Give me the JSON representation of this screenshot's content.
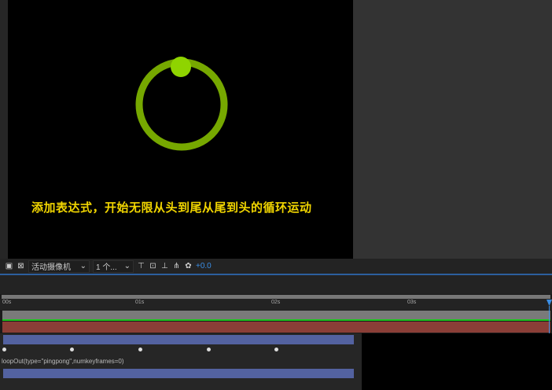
{
  "viewer": {
    "caption": "添加表达式，开始无限从头到尾从尾到头的循环运动",
    "ring_color": "#76a800",
    "dot_color": "#8fd400"
  },
  "toolbar": {
    "camera_select": "活动摄像机",
    "view_select": "1 个...",
    "exposure": "+0.0"
  },
  "timeline": {
    "ticks": [
      "00s",
      "01s",
      "02s",
      "03s"
    ],
    "expression": "loopOut(type=\"pingpong\",numkeyframes=0)",
    "keyframe_count": 5
  }
}
